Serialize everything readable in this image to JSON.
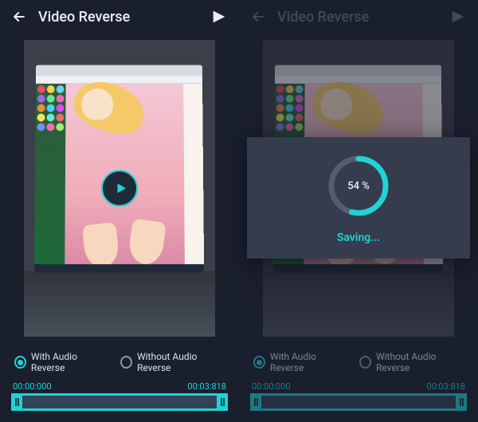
{
  "colors": {
    "accent": "#1fd3d6"
  },
  "left": {
    "header": {
      "title": "Video Reverse"
    },
    "options": {
      "with_audio": "With Audio Reverse",
      "without_audio": "Without Audio  Reverse",
      "selected": "with_audio"
    },
    "times": {
      "start": "00:00:000",
      "end": "00:03:818"
    }
  },
  "right": {
    "header": {
      "title": "Video Reverse"
    },
    "options": {
      "with_audio": "With Audio Reverse",
      "without_audio": "Without Audio  Reverse",
      "selected": "with_audio"
    },
    "times": {
      "start": "00:00:000",
      "end": "00:03:818"
    },
    "modal": {
      "percent_label": "54 %",
      "percent_value": 54,
      "status": "Saving..."
    }
  }
}
